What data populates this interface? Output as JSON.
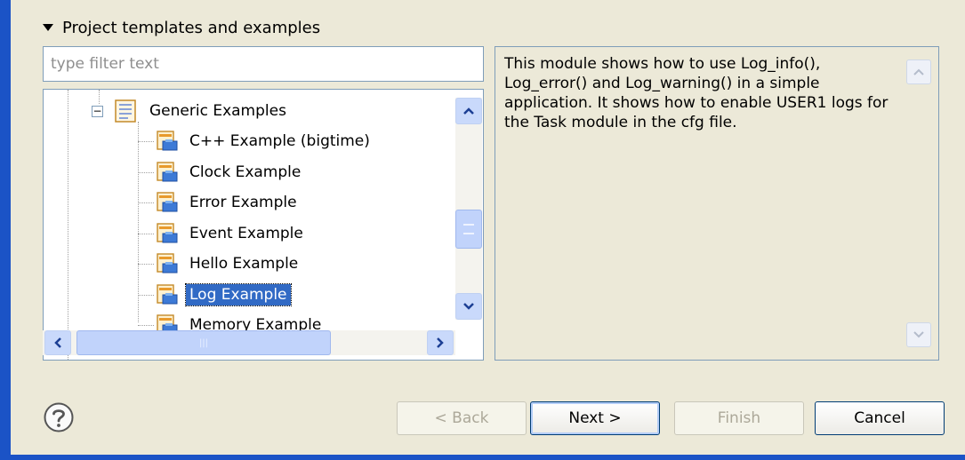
{
  "section": {
    "title": "Project templates and examples"
  },
  "filter": {
    "placeholder": "type filter text",
    "value": ""
  },
  "tree": {
    "group": {
      "label": "Generic Examples",
      "icon": "folder-list-icon",
      "expanded": true
    },
    "items": [
      {
        "label": "C++ Example (bigtime)",
        "icon": "example-project-icon"
      },
      {
        "label": "Clock Example",
        "icon": "example-project-icon"
      },
      {
        "label": "Error Example",
        "icon": "example-project-icon"
      },
      {
        "label": "Event Example",
        "icon": "example-project-icon"
      },
      {
        "label": "Hello Example",
        "icon": "example-project-icon"
      },
      {
        "label": "Log Example",
        "icon": "example-project-icon",
        "selected": true
      },
      {
        "label": "Memory Example",
        "icon": "example-project-icon"
      }
    ]
  },
  "description": {
    "text": "This module shows how to use Log_info(), Log_error() and Log_warning() in a simple application. It shows how to enable USER1 logs for the Task module in the cfg file."
  },
  "buttons": {
    "back": {
      "label": "< Back",
      "enabled": false
    },
    "next": {
      "label": "Next >",
      "enabled": true
    },
    "finish": {
      "label": "Finish",
      "enabled": false
    },
    "cancel": {
      "label": "Cancel",
      "enabled": true
    }
  },
  "colors": {
    "accent": "#1b53c6",
    "selection": "#316ac5",
    "background": "#ece9d8"
  }
}
